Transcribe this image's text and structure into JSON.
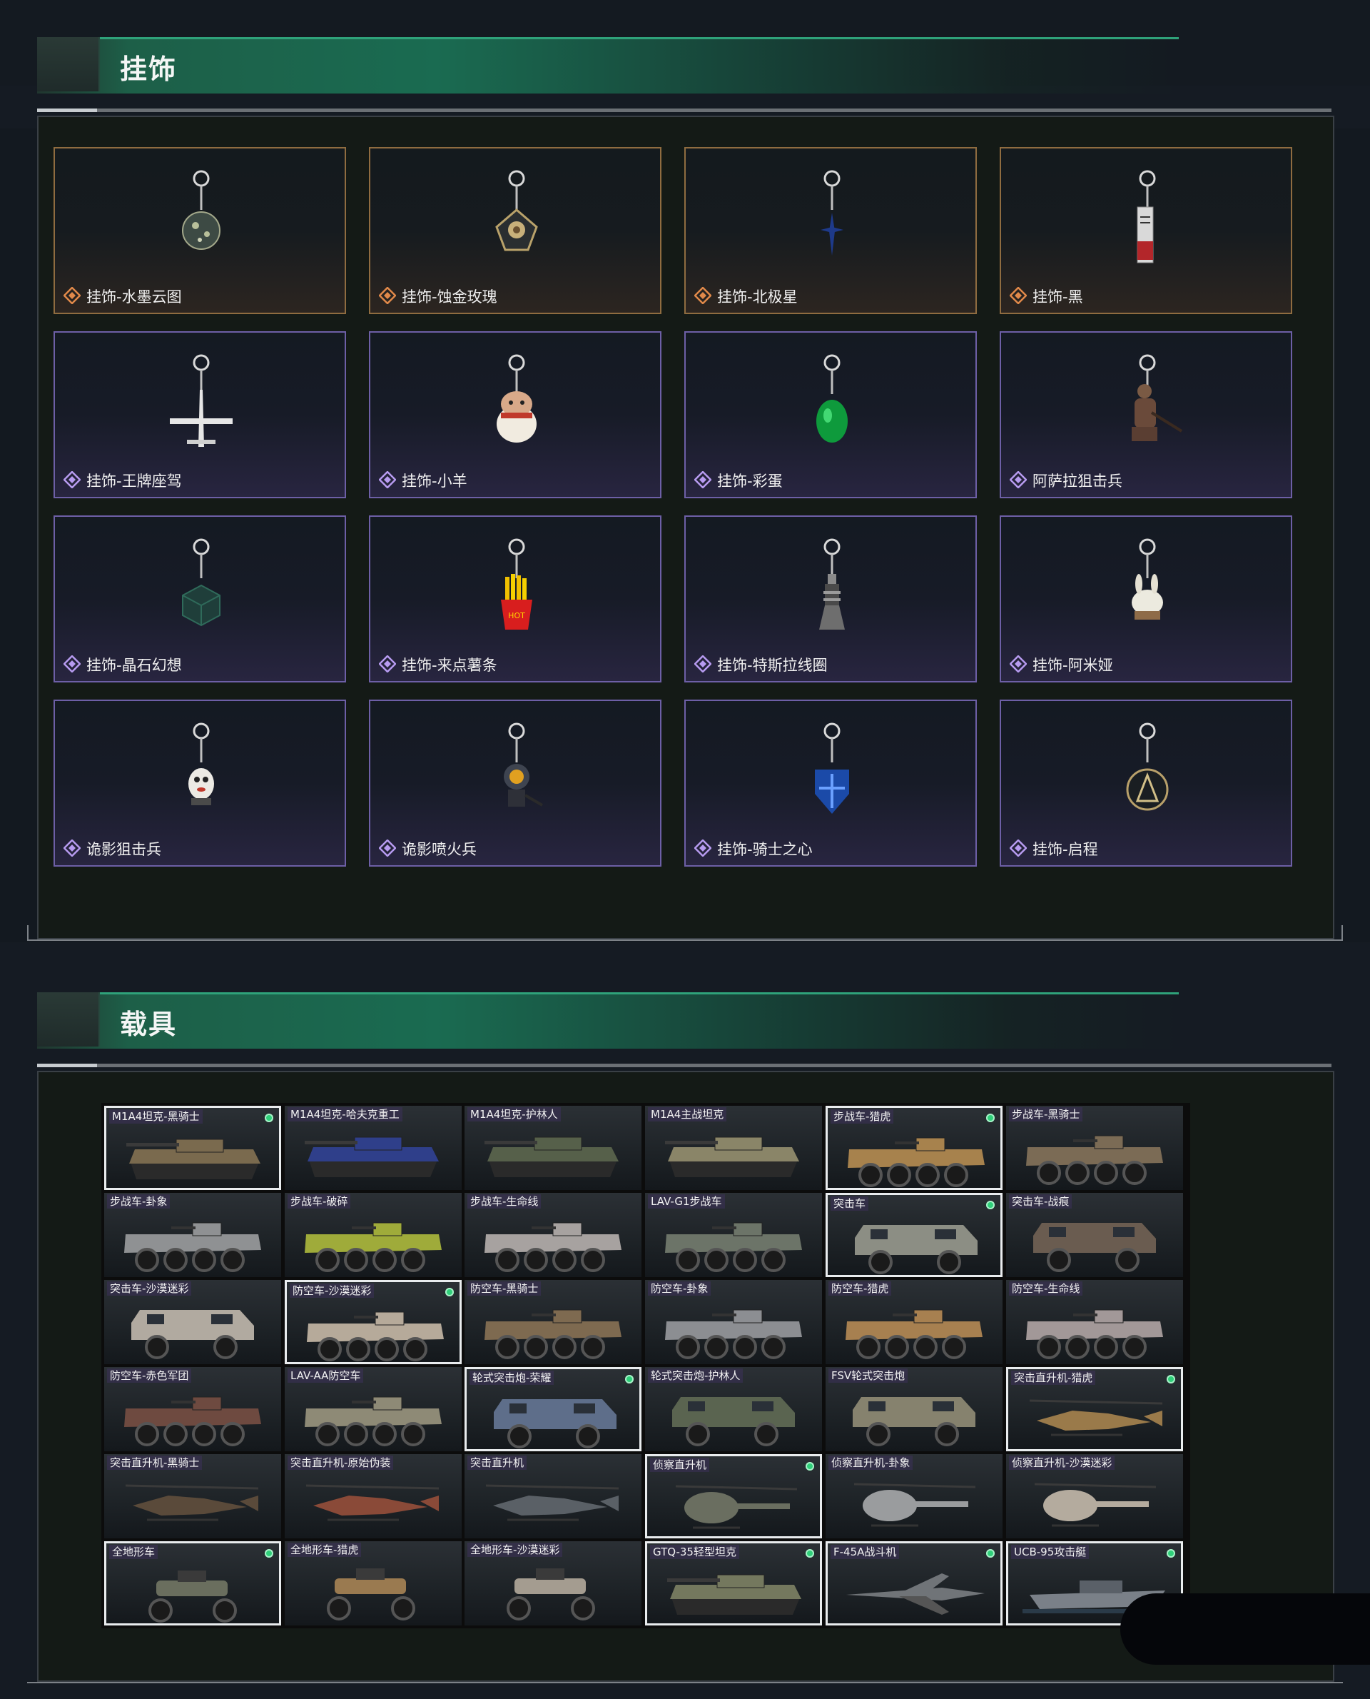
{
  "sections": {
    "charms": {
      "title": "挂饰",
      "items": [
        {
          "label": "挂饰-水墨云图",
          "rarity": "gold",
          "icon": "orb-charm-icon"
        },
        {
          "label": "挂饰-蚀金玫瑰",
          "rarity": "gold",
          "icon": "rose-charm-icon"
        },
        {
          "label": "挂饰-北极星",
          "rarity": "gold",
          "icon": "star-charm-icon"
        },
        {
          "label": "挂饰-黑",
          "rarity": "gold",
          "icon": "tag-charm-icon"
        },
        {
          "label": "挂饰-王牌座驾",
          "rarity": "purple",
          "icon": "jet-charm-icon"
        },
        {
          "label": "挂饰-小羊",
          "rarity": "purple",
          "icon": "sheep-charm-icon"
        },
        {
          "label": "挂饰-彩蛋",
          "rarity": "purple",
          "icon": "egg-charm-icon"
        },
        {
          "label": "阿萨拉狙击兵",
          "rarity": "purple",
          "icon": "soldier-charm-icon"
        },
        {
          "label": "挂饰-晶石幻想",
          "rarity": "purple",
          "icon": "cube-charm-icon"
        },
        {
          "label": "挂饰-来点薯条",
          "rarity": "purple",
          "icon": "fries-charm-icon"
        },
        {
          "label": "挂饰-特斯拉线圈",
          "rarity": "purple",
          "icon": "coil-charm-icon"
        },
        {
          "label": "挂饰-阿米娅",
          "rarity": "purple",
          "icon": "rabbit-charm-icon"
        },
        {
          "label": "诡影狙击兵",
          "rarity": "purple",
          "icon": "ghost-sniper-charm-icon"
        },
        {
          "label": "诡影喷火兵",
          "rarity": "purple",
          "icon": "ghost-flamer-charm-icon"
        },
        {
          "label": "挂饰-骑士之心",
          "rarity": "purple",
          "icon": "shield-charm-icon"
        },
        {
          "label": "挂饰-启程",
          "rarity": "purple",
          "icon": "medal-charm-icon"
        }
      ]
    },
    "vehicles": {
      "title": "载具",
      "items": [
        {
          "label": "M1A4坦克-黑骑士",
          "owned": true,
          "type": "tank",
          "color": "#7a6a4e"
        },
        {
          "label": "M1A4坦克-哈夫克重工",
          "owned": false,
          "type": "tank",
          "color": "#2f3f8a"
        },
        {
          "label": "M1A4坦克-护林人",
          "owned": false,
          "type": "tank",
          "color": "#56604a"
        },
        {
          "label": "M1A4主战坦克",
          "owned": false,
          "type": "tank",
          "color": "#8a8568"
        },
        {
          "label": "步战车-猎虎",
          "owned": true,
          "type": "ifv",
          "color": "#a7824d"
        },
        {
          "label": "步战车-黑骑士",
          "owned": false,
          "type": "ifv",
          "color": "#7b6b55"
        },
        {
          "label": "步战车-卦象",
          "owned": false,
          "type": "ifv",
          "color": "#8f9193"
        },
        {
          "label": "步战车-破碎",
          "owned": false,
          "type": "ifv",
          "color": "#9fab3a"
        },
        {
          "label": "步战车-生命线",
          "owned": false,
          "type": "ifv",
          "color": "#a7a2a0"
        },
        {
          "label": "LAV-G1步战车",
          "owned": false,
          "type": "ifv",
          "color": "#6c7468"
        },
        {
          "label": "突击车",
          "owned": true,
          "type": "mrap",
          "color": "#8c8e84"
        },
        {
          "label": "突击车-战痕",
          "owned": false,
          "type": "mrap",
          "color": "#6a5c50"
        },
        {
          "label": "突击车-沙漠迷彩",
          "owned": false,
          "type": "mrap",
          "color": "#b1aaa0"
        },
        {
          "label": "防空车-沙漠迷彩",
          "owned": true,
          "type": "ifv",
          "color": "#b6aa9a"
        },
        {
          "label": "防空车-黑骑士",
          "owned": false,
          "type": "ifv",
          "color": "#7e6a50"
        },
        {
          "label": "防空车-卦象",
          "owned": false,
          "type": "ifv",
          "color": "#8c8e92"
        },
        {
          "label": "防空车-猎虎",
          "owned": false,
          "type": "ifv",
          "color": "#a78050"
        },
        {
          "label": "防空车-生命线",
          "owned": false,
          "type": "ifv",
          "color": "#a29898"
        },
        {
          "label": "防空车-赤色军团",
          "owned": false,
          "type": "ifv",
          "color": "#6e4a40"
        },
        {
          "label": "LAV-AA防空车",
          "owned": false,
          "type": "ifv",
          "color": "#8e8a76"
        },
        {
          "label": "轮式突击炮-荣耀",
          "owned": true,
          "type": "mrap",
          "color": "#5e6e8a"
        },
        {
          "label": "轮式突击炮-护林人",
          "owned": false,
          "type": "mrap",
          "color": "#5a6450"
        },
        {
          "label": "FSV轮式突击炮",
          "owned": false,
          "type": "mrap",
          "color": "#86826e"
        },
        {
          "label": "突击直升机-猎虎",
          "owned": true,
          "type": "heli",
          "color": "#9a7a4a"
        },
        {
          "label": "突击直升机-黑骑士",
          "owned": false,
          "type": "heli",
          "color": "#5a4a3a"
        },
        {
          "label": "突击直升机-原始伪装",
          "owned": false,
          "type": "heli",
          "color": "#8a4a38"
        },
        {
          "label": "突击直升机",
          "owned": false,
          "type": "heli",
          "color": "#5a6066"
        },
        {
          "label": "侦察直升机",
          "owned": true,
          "type": "scout",
          "color": "#6a6e60"
        },
        {
          "label": "侦察直升机-卦象",
          "owned": false,
          "type": "scout",
          "color": "#9a9c9e"
        },
        {
          "label": "侦察直升机-沙漠迷彩",
          "owned": false,
          "type": "scout",
          "color": "#b4ab9e"
        },
        {
          "label": "全地形车",
          "owned": true,
          "type": "atv",
          "color": "#6a6e5e"
        },
        {
          "label": "全地形车-猎虎",
          "owned": false,
          "type": "atv",
          "color": "#9a7a50"
        },
        {
          "label": "全地形车-沙漠迷彩",
          "owned": false,
          "type": "atv",
          "color": "#a49c90"
        },
        {
          "label": "GTQ-35轻型坦克",
          "owned": true,
          "type": "tank",
          "color": "#74785e"
        },
        {
          "label": "F-45A战斗机",
          "owned": true,
          "type": "jet",
          "color": "#707478"
        },
        {
          "label": "UCB-95攻击艇",
          "owned": true,
          "type": "boat",
          "color": "#7a8088"
        }
      ]
    }
  }
}
